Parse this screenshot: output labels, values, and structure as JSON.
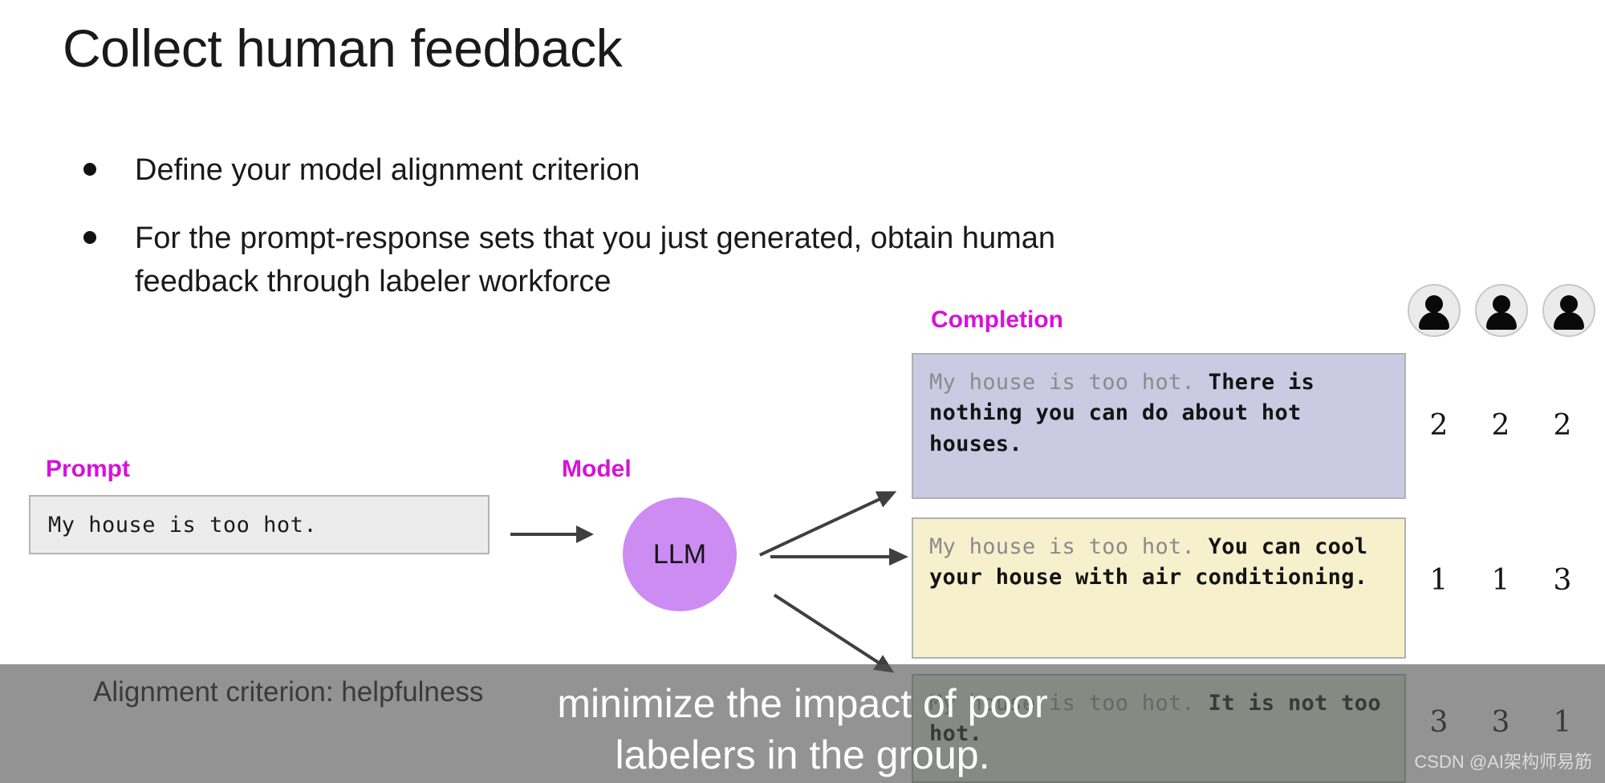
{
  "slide": {
    "title": "Collect human feedback",
    "bullets": [
      "Define your model alignment criterion",
      "For the prompt-response sets that you just generated, obtain human feedback through labeler workforce"
    ],
    "alignment_criterion": "Alignment criterion: helpfulness"
  },
  "labels": {
    "prompt": "Prompt",
    "model": "Model",
    "completion": "Completion"
  },
  "prompt": {
    "text": "My house is too hot."
  },
  "model": {
    "name": "LLM"
  },
  "completions": [
    {
      "echo": "My house is too hot.",
      "response": "There is nothing you can do about hot houses.",
      "bg_color": "#ccc9e3",
      "ranks": [
        "2",
        "2",
        "2"
      ]
    },
    {
      "echo": "My house is too hot.",
      "response": "You can cool your house with air conditioning.",
      "bg_color": "#f7f0cd",
      "ranks": [
        "1",
        "1",
        "3"
      ]
    },
    {
      "echo": "My house is too hot.",
      "response": "It is not too hot.",
      "bg_color": "#dde6d4",
      "ranks": [
        "3",
        "3",
        "1"
      ]
    }
  ],
  "labelers": [
    {
      "icon": "person-icon"
    },
    {
      "icon": "person-icon"
    },
    {
      "icon": "person-icon"
    }
  ],
  "caption": {
    "line1": "minimize the impact of poor",
    "line2": "labelers in the group."
  },
  "watermark": "CSDN @AI架构师易筋",
  "colors": {
    "accent_magenta": "#d612d6",
    "llm_purple": "#cc8cf2",
    "prompt_gray": "#ececec",
    "arrow_gray": "#3f3f3f"
  }
}
